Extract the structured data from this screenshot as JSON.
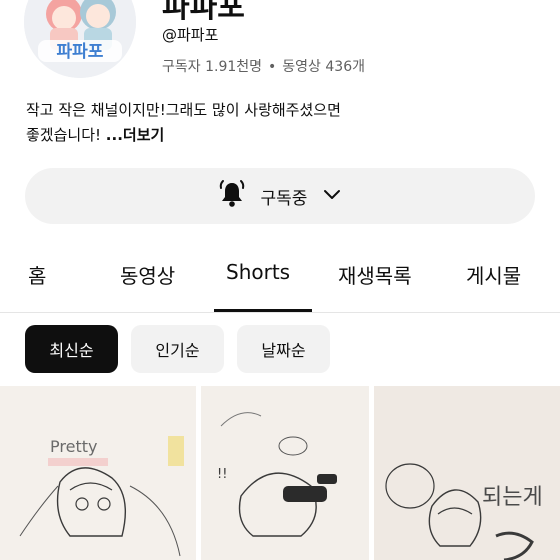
{
  "channel": {
    "name": "파파포",
    "handle": "@파파포",
    "subscribers": "구독자 1.91천명",
    "separator": "•",
    "videos": "동영상 436개",
    "description_line1": "작고 작은 채널이지만!그래도 많이 사랑해주셨으면",
    "description_line2": "좋겠습니다! ",
    "more": "...더보기",
    "avatar_text": "파파포"
  },
  "subscribe": {
    "label": "구독중",
    "bell_icon": "bell-ringing-icon",
    "chevron_icon": "chevron-down-icon"
  },
  "tabs": [
    {
      "label": "홈"
    },
    {
      "label": "동영상"
    },
    {
      "label": "Shorts",
      "active": true
    },
    {
      "label": "재생목록"
    },
    {
      "label": "게시물"
    }
  ],
  "sort_chips": [
    {
      "label": "최신순",
      "selected": true
    },
    {
      "label": "인기순",
      "selected": false
    },
    {
      "label": "날짜순",
      "selected": false
    }
  ],
  "shorts": [
    {
      "sketch_text": "Pretty"
    },
    {
      "sketch_text": "!!"
    },
    {
      "sketch_text": "되는게"
    }
  ]
}
